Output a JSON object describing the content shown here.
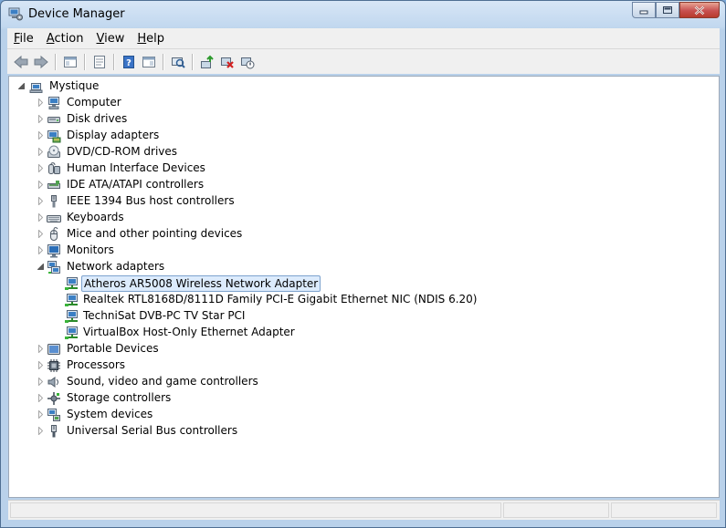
{
  "window": {
    "title": "Device Manager",
    "app_icon": "device-manager-icon"
  },
  "caption_buttons": [
    "minimize",
    "maximize",
    "close"
  ],
  "menu": [
    {
      "label": "File",
      "underline": "F"
    },
    {
      "label": "Action",
      "underline": "A"
    },
    {
      "label": "View",
      "underline": "V"
    },
    {
      "label": "Help",
      "underline": "H"
    }
  ],
  "toolbar": [
    "back",
    "forward",
    "show-hide-console-tree",
    "properties",
    "help",
    "action-pane",
    "scan-hardware",
    "update-driver",
    "uninstall",
    "disable"
  ],
  "tree": {
    "root": "Mystique",
    "categories": [
      {
        "label": "Computer",
        "icon": "computer-icon"
      },
      {
        "label": "Disk drives",
        "icon": "disk-drive-icon"
      },
      {
        "label": "Display adapters",
        "icon": "display-adapter-icon"
      },
      {
        "label": "DVD/CD-ROM drives",
        "icon": "dvd-drive-icon"
      },
      {
        "label": "Human Interface Devices",
        "icon": "hid-icon"
      },
      {
        "label": "IDE ATA/ATAPI controllers",
        "icon": "ide-controller-icon"
      },
      {
        "label": "IEEE 1394 Bus host controllers",
        "icon": "ieee1394-icon"
      },
      {
        "label": "Keyboards",
        "icon": "keyboard-icon"
      },
      {
        "label": "Mice and other pointing devices",
        "icon": "mouse-icon"
      },
      {
        "label": "Monitors",
        "icon": "monitor-icon"
      },
      {
        "label": "Network adapters",
        "icon": "network-adapter-icon",
        "expanded": true,
        "children": [
          {
            "label": "Atheros AR5008 Wireless Network Adapter",
            "selected": true
          },
          {
            "label": "Realtek RTL8168D/8111D Family PCI-E Gigabit Ethernet NIC (NDIS 6.20)"
          },
          {
            "label": "TechniSat DVB-PC TV Star PCI"
          },
          {
            "label": "VirtualBox Host-Only Ethernet Adapter"
          }
        ]
      },
      {
        "label": "Portable Devices",
        "icon": "portable-device-icon"
      },
      {
        "label": "Processors",
        "icon": "processor-icon"
      },
      {
        "label": "Sound, video and game controllers",
        "icon": "sound-icon"
      },
      {
        "label": "Storage controllers",
        "icon": "storage-controller-icon"
      },
      {
        "label": "System devices",
        "icon": "system-device-icon"
      },
      {
        "label": "Universal Serial Bus controllers",
        "icon": "usb-icon"
      }
    ]
  },
  "colors": {
    "selection_bg": "#dcebfc",
    "selection_border": "#7da2ce",
    "close_button": "#c75050"
  }
}
